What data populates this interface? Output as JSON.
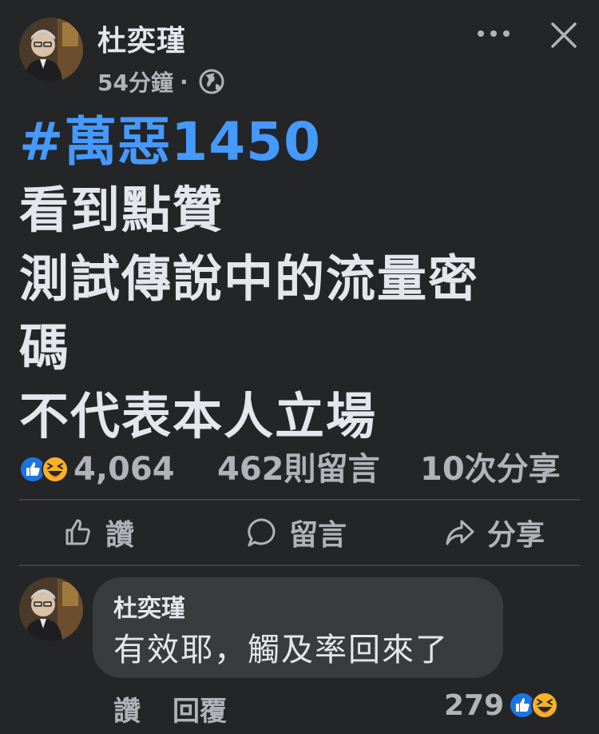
{
  "post": {
    "author": "杜奕瑾",
    "time": "54分鐘",
    "dot": "·",
    "visibility_icon": "globe-icon",
    "hashtag": "#萬惡1450",
    "lines": [
      "看到點贊",
      "測試傳說中的流量密",
      "碼",
      "不代表本人立場"
    ]
  },
  "stats": {
    "reaction_icons": [
      "like-icon",
      "haha-icon"
    ],
    "reactions": "4,064",
    "comments": "462則留言",
    "shares": "10次分享"
  },
  "actions": {
    "like": "讚",
    "comment": "留言",
    "share": "分享"
  },
  "comment": {
    "author": "杜奕瑾",
    "text": "有效耶，觸及率回來了",
    "like": "讚",
    "reply": "回覆",
    "reactions": "279"
  },
  "colors": {
    "background": "#242526",
    "hashtag": "#4599ff",
    "text": "#e4e6eb",
    "secondary": "#b0b3b8",
    "bubble": "#3a3b3c",
    "like": "#1b74e4",
    "haha": "#f7b125"
  }
}
